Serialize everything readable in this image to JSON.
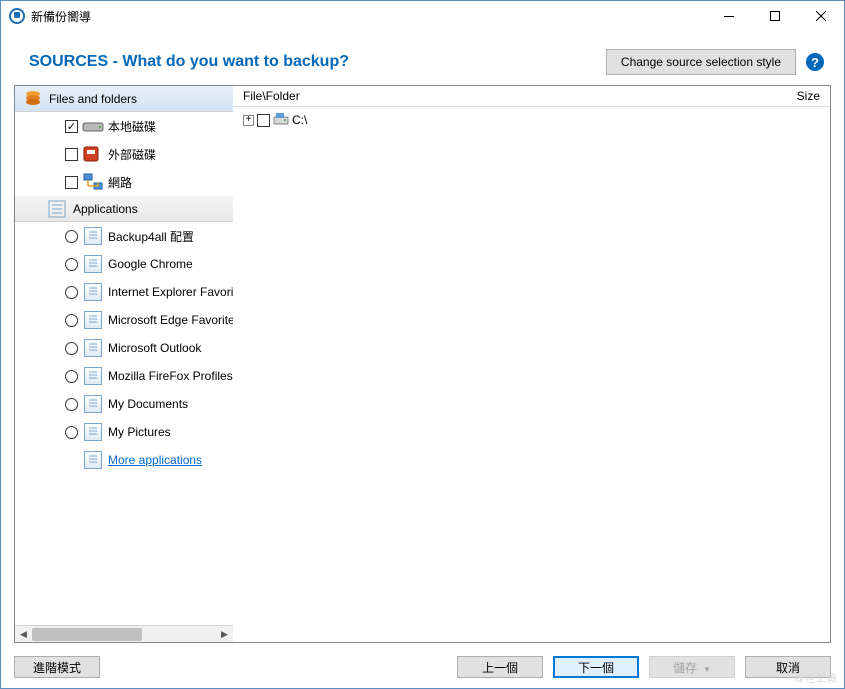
{
  "window": {
    "title": "新備份嚮導"
  },
  "header": {
    "title": "SOURCES - What do you want to backup?",
    "change_style": "Change source selection style"
  },
  "sidebar": {
    "cat_files": "Files and folders",
    "cat_apps": "Applications",
    "sources": [
      {
        "label": "本地磁碟",
        "checked": true
      },
      {
        "label": "外部磁碟",
        "checked": false
      },
      {
        "label": "網路",
        "checked": false
      }
    ],
    "apps": [
      {
        "label": "Backup4all 配置"
      },
      {
        "label": "Google Chrome"
      },
      {
        "label": "Internet Explorer Favorites"
      },
      {
        "label": "Microsoft Edge Favorites"
      },
      {
        "label": "Microsoft Outlook"
      },
      {
        "label": "Mozilla FireFox Profiles"
      },
      {
        "label": "My Documents"
      },
      {
        "label": "My Pictures"
      }
    ],
    "more": "More applications"
  },
  "content": {
    "col_file": "File\\Folder",
    "col_size": "Size",
    "tree_root": "C:\\"
  },
  "footer": {
    "advanced": "進階模式",
    "prev": "上一個",
    "next": "下一個",
    "save": "儲存",
    "cancel": "取消"
  },
  "watermark": "綠色工廠"
}
